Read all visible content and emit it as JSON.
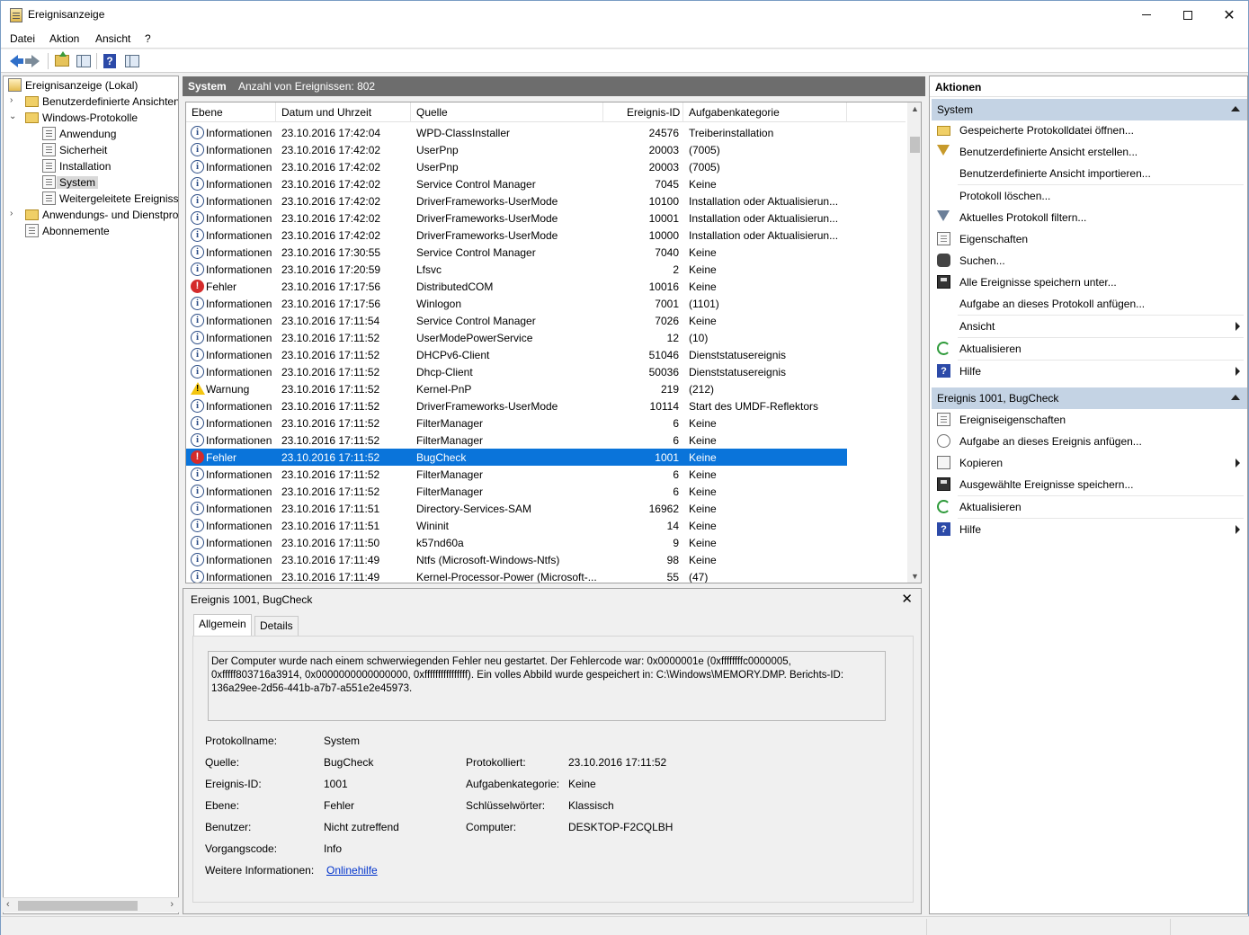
{
  "window": {
    "title": "Ereignisanzeige"
  },
  "menu": [
    "Datei",
    "Aktion",
    "Ansicht",
    "?"
  ],
  "tree": {
    "root": "Ereignisanzeige (Lokal)",
    "custom_views": "Benutzerdefinierte Ansichten",
    "windows_logs": "Windows-Protokolle",
    "logs": [
      "Anwendung",
      "Sicherheit",
      "Installation",
      "System",
      "Weitergeleitete Ereignisse"
    ],
    "app_services": "Anwendungs- und Dienstprotokolle",
    "subscriptions": "Abonnemente"
  },
  "center": {
    "log_name": "System",
    "event_count": "Anzahl von Ereignissen: 802",
    "columns": [
      "Ebene",
      "Datum und Uhrzeit",
      "Quelle",
      "Ereignis-ID",
      "Aufgabenkategorie"
    ],
    "rows": [
      {
        "icon": "info",
        "level": "Informationen",
        "date": "23.10.2016 17:42:04",
        "source": "WPD-ClassInstaller",
        "id": "24576",
        "task": "Treiberinstallation"
      },
      {
        "icon": "info",
        "level": "Informationen",
        "date": "23.10.2016 17:42:02",
        "source": "UserPnp",
        "id": "20003",
        "task": "(7005)"
      },
      {
        "icon": "info",
        "level": "Informationen",
        "date": "23.10.2016 17:42:02",
        "source": "UserPnp",
        "id": "20003",
        "task": "(7005)"
      },
      {
        "icon": "info",
        "level": "Informationen",
        "date": "23.10.2016 17:42:02",
        "source": "Service Control Manager",
        "id": "7045",
        "task": "Keine"
      },
      {
        "icon": "info",
        "level": "Informationen",
        "date": "23.10.2016 17:42:02",
        "source": "DriverFrameworks-UserMode",
        "id": "10100",
        "task": "Installation oder Aktualisierun..."
      },
      {
        "icon": "info",
        "level": "Informationen",
        "date": "23.10.2016 17:42:02",
        "source": "DriverFrameworks-UserMode",
        "id": "10001",
        "task": "Installation oder Aktualisierun..."
      },
      {
        "icon": "info",
        "level": "Informationen",
        "date": "23.10.2016 17:42:02",
        "source": "DriverFrameworks-UserMode",
        "id": "10000",
        "task": "Installation oder Aktualisierun..."
      },
      {
        "icon": "info",
        "level": "Informationen",
        "date": "23.10.2016 17:30:55",
        "source": "Service Control Manager",
        "id": "7040",
        "task": "Keine"
      },
      {
        "icon": "info",
        "level": "Informationen",
        "date": "23.10.2016 17:20:59",
        "source": "Lfsvc",
        "id": "2",
        "task": "Keine"
      },
      {
        "icon": "error",
        "level": "Fehler",
        "date": "23.10.2016 17:17:56",
        "source": "DistributedCOM",
        "id": "10016",
        "task": "Keine"
      },
      {
        "icon": "info",
        "level": "Informationen",
        "date": "23.10.2016 17:17:56",
        "source": "Winlogon",
        "id": "7001",
        "task": "(1101)"
      },
      {
        "icon": "info",
        "level": "Informationen",
        "date": "23.10.2016 17:11:54",
        "source": "Service Control Manager",
        "id": "7026",
        "task": "Keine"
      },
      {
        "icon": "info",
        "level": "Informationen",
        "date": "23.10.2016 17:11:52",
        "source": "UserModePowerService",
        "id": "12",
        "task": "(10)"
      },
      {
        "icon": "info",
        "level": "Informationen",
        "date": "23.10.2016 17:11:52",
        "source": "DHCPv6-Client",
        "id": "51046",
        "task": "Dienststatusereignis"
      },
      {
        "icon": "info",
        "level": "Informationen",
        "date": "23.10.2016 17:11:52",
        "source": "Dhcp-Client",
        "id": "50036",
        "task": "Dienststatusereignis"
      },
      {
        "icon": "warn",
        "level": "Warnung",
        "date": "23.10.2016 17:11:52",
        "source": "Kernel-PnP",
        "id": "219",
        "task": "(212)"
      },
      {
        "icon": "info",
        "level": "Informationen",
        "date": "23.10.2016 17:11:52",
        "source": "DriverFrameworks-UserMode",
        "id": "10114",
        "task": "Start des UMDF-Reflektors"
      },
      {
        "icon": "info",
        "level": "Informationen",
        "date": "23.10.2016 17:11:52",
        "source": "FilterManager",
        "id": "6",
        "task": "Keine"
      },
      {
        "icon": "info",
        "level": "Informationen",
        "date": "23.10.2016 17:11:52",
        "source": "FilterManager",
        "id": "6",
        "task": "Keine"
      },
      {
        "icon": "error",
        "level": "Fehler",
        "date": "23.10.2016 17:11:52",
        "source": "BugCheck",
        "id": "1001",
        "task": "Keine",
        "selected": true
      },
      {
        "icon": "info",
        "level": "Informationen",
        "date": "23.10.2016 17:11:52",
        "source": "FilterManager",
        "id": "6",
        "task": "Keine"
      },
      {
        "icon": "info",
        "level": "Informationen",
        "date": "23.10.2016 17:11:52",
        "source": "FilterManager",
        "id": "6",
        "task": "Keine"
      },
      {
        "icon": "info",
        "level": "Informationen",
        "date": "23.10.2016 17:11:51",
        "source": "Directory-Services-SAM",
        "id": "16962",
        "task": "Keine"
      },
      {
        "icon": "info",
        "level": "Informationen",
        "date": "23.10.2016 17:11:51",
        "source": "Wininit",
        "id": "14",
        "task": "Keine"
      },
      {
        "icon": "info",
        "level": "Informationen",
        "date": "23.10.2016 17:11:50",
        "source": "k57nd60a",
        "id": "9",
        "task": "Keine"
      },
      {
        "icon": "info",
        "level": "Informationen",
        "date": "23.10.2016 17:11:49",
        "source": "Ntfs (Microsoft-Windows-Ntfs)",
        "id": "98",
        "task": "Keine"
      },
      {
        "icon": "info",
        "level": "Informationen",
        "date": "23.10.2016 17:11:49",
        "source": "Kernel-Processor-Power (Microsoft-...",
        "id": "55",
        "task": "(47)"
      }
    ]
  },
  "detail": {
    "title": "Ereignis 1001, BugCheck",
    "tabs": [
      "Allgemein",
      "Details"
    ],
    "description": "Der Computer wurde nach einem schwerwiegenden Fehler neu gestartet. Der Fehlercode war: 0x0000001e (0xffffffffc0000005, 0xfffff803716a3914, 0x0000000000000000, 0xffffffffffffffff). Ein volles Abbild wurde gespeichert in: C:\\Windows\\MEMORY.DMP. Berichts-ID: 136a29ee-2d56-441b-a7b7-a551e2e45973.",
    "log_name_label": "Protokollname:",
    "log_name": "System",
    "source_label": "Quelle:",
    "source": "BugCheck",
    "logged_label": "Protokolliert:",
    "logged": "23.10.2016 17:11:52",
    "event_id_label": "Ereignis-ID:",
    "event_id": "1001",
    "task_label": "Aufgabenkategorie:",
    "task": "Keine",
    "level_label": "Ebene:",
    "level": "Fehler",
    "keywords_label": "Schlüsselwörter:",
    "keywords": "Klassisch",
    "user_label": "Benutzer:",
    "user": "Nicht zutreffend",
    "computer_label": "Computer:",
    "computer": "DESKTOP-F2CQLBH",
    "opcode_label": "Vorgangscode:",
    "opcode": "Info",
    "more_info_label": "Weitere Informationen:",
    "more_info_link": "Onlinehilfe"
  },
  "actions": {
    "title": "Aktionen",
    "group1": "System",
    "items1": [
      "Gespeicherte Protokolldatei öffnen...",
      "Benutzerdefinierte Ansicht erstellen...",
      "Benutzerdefinierte Ansicht importieren...",
      "Protokoll löschen...",
      "Aktuelles Protokoll filtern...",
      "Eigenschaften",
      "Suchen...",
      "Alle Ereignisse speichern unter...",
      "Aufgabe an dieses Protokoll anfügen...",
      "Ansicht",
      "Aktualisieren",
      "Hilfe"
    ],
    "group2": "Ereignis 1001, BugCheck",
    "items2": [
      "Ereigniseigenschaften",
      "Aufgabe an dieses Ereignis anfügen...",
      "Kopieren",
      "Ausgewählte Ereignisse speichern...",
      "Aktualisieren",
      "Hilfe"
    ]
  }
}
